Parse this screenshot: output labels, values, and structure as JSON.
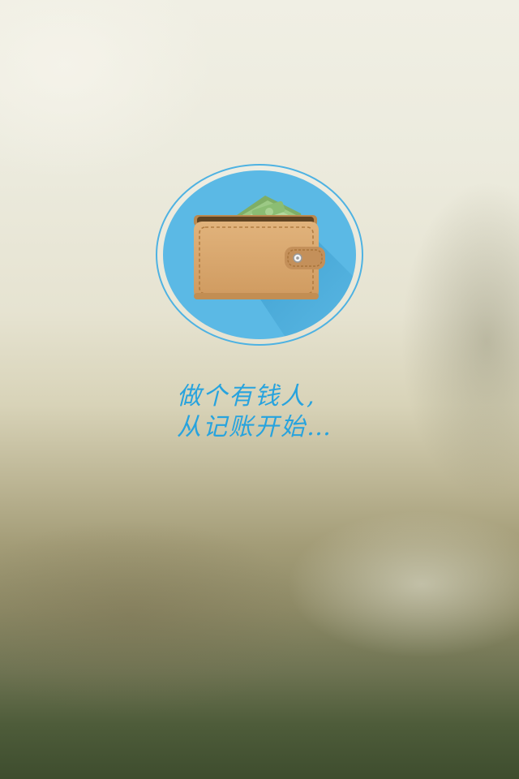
{
  "splash": {
    "slogan_line1": "做个有钱人,",
    "slogan_line2": "从记账开始…",
    "logo_icon": "wallet-icon",
    "colors": {
      "circle_fill": "#5bb9e5",
      "circle_ring": "#4eb2e2",
      "wallet": "#d7a56a",
      "cash": "#8bbd73",
      "slogan_text": "#27a3de"
    }
  }
}
